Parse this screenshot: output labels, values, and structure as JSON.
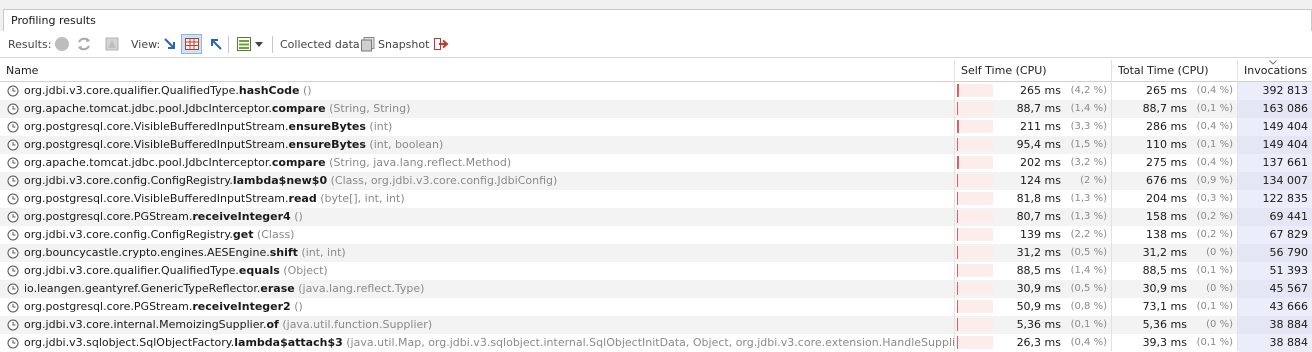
{
  "tab": {
    "title": "Profiling results"
  },
  "toolbar": {
    "results_label": "Results:",
    "view_label": "View:",
    "collected_label": "Collected data:",
    "snapshot_label": "Snapshot"
  },
  "columns": {
    "name": "Name",
    "self": "Self Time (CPU)",
    "total": "Total Time (CPU)",
    "invocations": "Invocations",
    "sorted_column": "Invocations"
  },
  "rows": [
    {
      "pkg": "org.jdbi.v3.core.qualifier.QualifiedType.",
      "method": "hashCode",
      "args": " ()",
      "self": "265 ms",
      "self_pct": "(4,2 %)",
      "self_fraction": 0.042,
      "total": "265 ms",
      "total_pct": "(0,4 %)",
      "inv": "392 813"
    },
    {
      "pkg": "org.apache.tomcat.jdbc.pool.JdbcInterceptor.",
      "method": "compare",
      "args": " (String, String)",
      "self": "88,7 ms",
      "self_pct": "(1,4 %)",
      "self_fraction": 0.014,
      "total": "88,7 ms",
      "total_pct": "(0,1 %)",
      "inv": "163 086"
    },
    {
      "pkg": "org.postgresql.core.VisibleBufferedInputStream.",
      "method": "ensureBytes",
      "args": " (int)",
      "self": "211 ms",
      "self_pct": "(3,3 %)",
      "self_fraction": 0.033,
      "total": "286 ms",
      "total_pct": "(0,4 %)",
      "inv": "149 404"
    },
    {
      "pkg": "org.postgresql.core.VisibleBufferedInputStream.",
      "method": "ensureBytes",
      "args": " (int, boolean)",
      "self": "95,4 ms",
      "self_pct": "(1,5 %)",
      "self_fraction": 0.015,
      "total": "110 ms",
      "total_pct": "(0,1 %)",
      "inv": "149 404"
    },
    {
      "pkg": "org.apache.tomcat.jdbc.pool.JdbcInterceptor.",
      "method": "compare",
      "args": " (String, java.lang.reflect.Method)",
      "self": "202 ms",
      "self_pct": "(3,2 %)",
      "self_fraction": 0.032,
      "total": "275 ms",
      "total_pct": "(0,4 %)",
      "inv": "137 661"
    },
    {
      "pkg": "org.jdbi.v3.core.config.ConfigRegistry.",
      "method": "lambda$new$0",
      "args": " (Class, org.jdbi.v3.core.config.JdbiConfig)",
      "self": "124 ms",
      "self_pct": "(2 %)",
      "self_fraction": 0.02,
      "total": "676 ms",
      "total_pct": "(0,9 %)",
      "inv": "134 007"
    },
    {
      "pkg": "org.postgresql.core.VisibleBufferedInputStream.",
      "method": "read",
      "args": " (byte[], int, int)",
      "self": "81,8 ms",
      "self_pct": "(1,3 %)",
      "self_fraction": 0.013,
      "total": "204 ms",
      "total_pct": "(0,3 %)",
      "inv": "122 835"
    },
    {
      "pkg": "org.postgresql.core.PGStream.",
      "method": "receiveInteger4",
      "args": " ()",
      "self": "80,7 ms",
      "self_pct": "(1,3 %)",
      "self_fraction": 0.013,
      "total": "158 ms",
      "total_pct": "(0,2 %)",
      "inv": "69 441"
    },
    {
      "pkg": "org.jdbi.v3.core.config.ConfigRegistry.",
      "method": "get",
      "args": " (Class)",
      "self": "139 ms",
      "self_pct": "(2,2 %)",
      "self_fraction": 0.022,
      "total": "138 ms",
      "total_pct": "(0,2 %)",
      "inv": "67 829"
    },
    {
      "pkg": "org.bouncycastle.crypto.engines.AESEngine.",
      "method": "shift",
      "args": " (int, int)",
      "self": "31,2 ms",
      "self_pct": "(0,5 %)",
      "self_fraction": 0.005,
      "total": "31,2 ms",
      "total_pct": "(0 %)",
      "inv": "56 790"
    },
    {
      "pkg": "org.jdbi.v3.core.qualifier.QualifiedType.",
      "method": "equals",
      "args": " (Object)",
      "self": "88,5 ms",
      "self_pct": "(1,4 %)",
      "self_fraction": 0.014,
      "total": "88,5 ms",
      "total_pct": "(0,1 %)",
      "inv": "51 393"
    },
    {
      "pkg": "io.leangen.geantyref.GenericTypeReflector.",
      "method": "erase",
      "args": " (java.lang.reflect.Type)",
      "self": "30,9 ms",
      "self_pct": "(0,5 %)",
      "self_fraction": 0.005,
      "total": "30,9 ms",
      "total_pct": "(0 %)",
      "inv": "45 567"
    },
    {
      "pkg": "org.postgresql.core.PGStream.",
      "method": "receiveInteger2",
      "args": " ()",
      "self": "50,9 ms",
      "self_pct": "(0,8 %)",
      "self_fraction": 0.008,
      "total": "73,1 ms",
      "total_pct": "(0,1 %)",
      "inv": "43 666"
    },
    {
      "pkg": "org.jdbi.v3.core.internal.MemoizingSupplier.",
      "method": "of",
      "args": " (java.util.function.Supplier)",
      "self": "5,36 ms",
      "self_pct": "(0,1 %)",
      "self_fraction": 0.001,
      "total": "5,36 ms",
      "total_pct": "(0 %)",
      "inv": "38 884"
    },
    {
      "pkg": "org.jdbi.v3.sqlobject.SqlObjectFactory.",
      "method": "lambda$attach$3",
      "args": " (java.util.Map, org.jdbi.v3.sqlobject.internal.SqlObjectInitData, Object, org.jdbi.v3.core.extension.HandleSupplier, org.jdbi.v3.core",
      "self": "26,3 ms",
      "self_pct": "(0,4 %)",
      "self_fraction": 0.004,
      "total": "39,3 ms",
      "total_pct": "(0,1 %)",
      "inv": "38 884"
    }
  ]
}
